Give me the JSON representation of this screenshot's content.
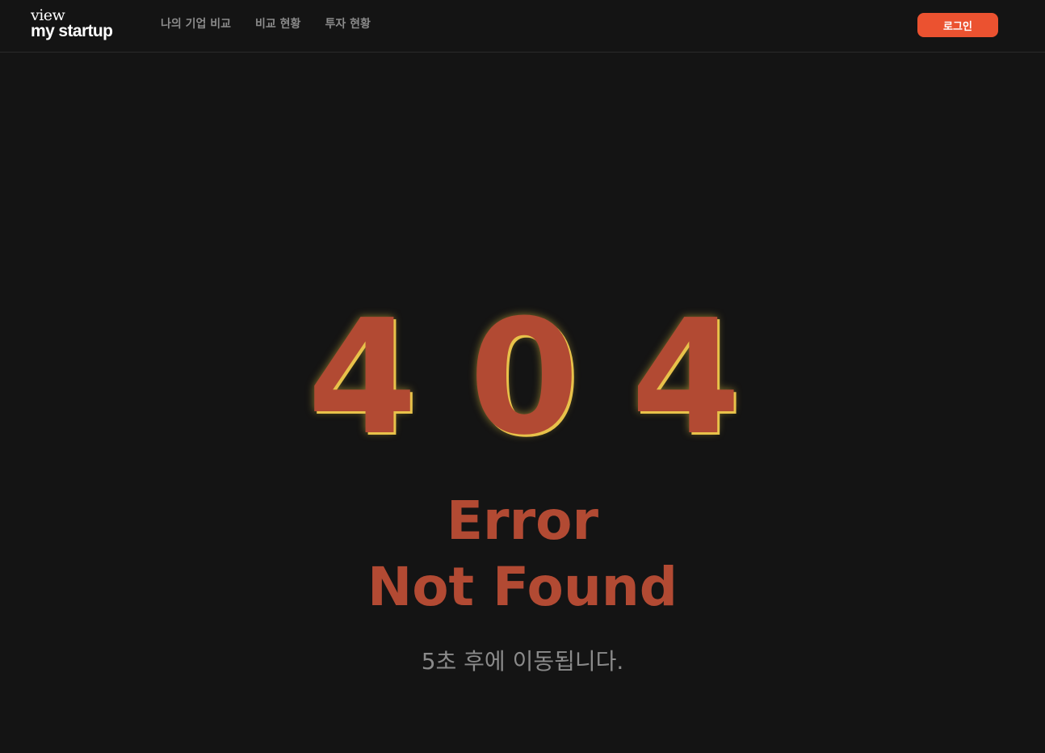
{
  "header": {
    "logo_top": "view",
    "logo_bottom": "my startup",
    "nav": [
      {
        "label": "나의 기업 비교"
      },
      {
        "label": "비교 현황"
      },
      {
        "label": "투자 현황"
      }
    ],
    "login_label": "로그인"
  },
  "main": {
    "code_digits": [
      "4",
      "0",
      "4"
    ],
    "error_line1": "Error",
    "error_line2": "Not Found",
    "redirect_message": "5초 후에 이동됩니다."
  },
  "colors": {
    "background": "#141414",
    "accent": "#eb5230",
    "error_text": "#b24a33",
    "glow": "#e8c24a",
    "nav_text": "#8a8a8a"
  }
}
